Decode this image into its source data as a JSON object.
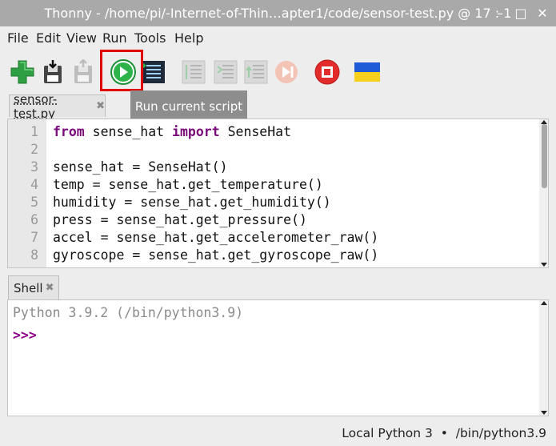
{
  "window": {
    "title": "Thonny  -  /home/pi/-Internet-of-Thin…apter1/code/sensor-test.py  @  17 : 1",
    "minimize": "–",
    "maximize": "□",
    "close": "✕"
  },
  "menubar": {
    "items": [
      "File",
      "Edit",
      "View",
      "Run",
      "Tools",
      "Help"
    ]
  },
  "toolbar": {
    "buttons": [
      "new-file",
      "load-file",
      "save-file",
      "run",
      "debug",
      "step-over",
      "step-into",
      "step-out",
      "resume",
      "stop",
      "support-ukraine"
    ],
    "highlight_color": "#e00000"
  },
  "tooltip": {
    "text": "Run current script"
  },
  "editor": {
    "tab_label": "sensor-test.py",
    "tab_close": "✖",
    "lines": [
      {
        "num": "1",
        "parts": [
          {
            "t": "from",
            "kw": true
          },
          {
            "t": " sense_hat "
          },
          {
            "t": "import",
            "kw": true
          },
          {
            "t": " SenseHat"
          }
        ]
      },
      {
        "num": "2",
        "parts": []
      },
      {
        "num": "3",
        "parts": [
          {
            "t": "sense_hat = SenseHat()"
          }
        ]
      },
      {
        "num": "4",
        "parts": [
          {
            "t": "temp = sense_hat.get_temperature()"
          }
        ]
      },
      {
        "num": "5",
        "parts": [
          {
            "t": "humidity = sense_hat.get_humidity()"
          }
        ]
      },
      {
        "num": "6",
        "parts": [
          {
            "t": "press = sense_hat.get_pressure()"
          }
        ]
      },
      {
        "num": "7",
        "parts": [
          {
            "t": "accel = sense_hat.get_accelerometer_raw()"
          }
        ]
      },
      {
        "num": "8",
        "parts": [
          {
            "t": "gyroscope = sense_hat.get_gyroscope_raw()"
          }
        ]
      }
    ]
  },
  "shell": {
    "tab_label": "Shell",
    "tab_close": "✖",
    "banner": "Python 3.9.2 (/bin/python3.9)",
    "prompt": ">>>"
  },
  "statusbar": {
    "text": "Local Python 3  •  /bin/python3.9"
  },
  "colors": {
    "keyword": "#7a0a7a",
    "prompt": "#8b008b",
    "banner": "#8a8a8a",
    "run_green": "#2db34a",
    "stop_red": "#e22b2b"
  }
}
